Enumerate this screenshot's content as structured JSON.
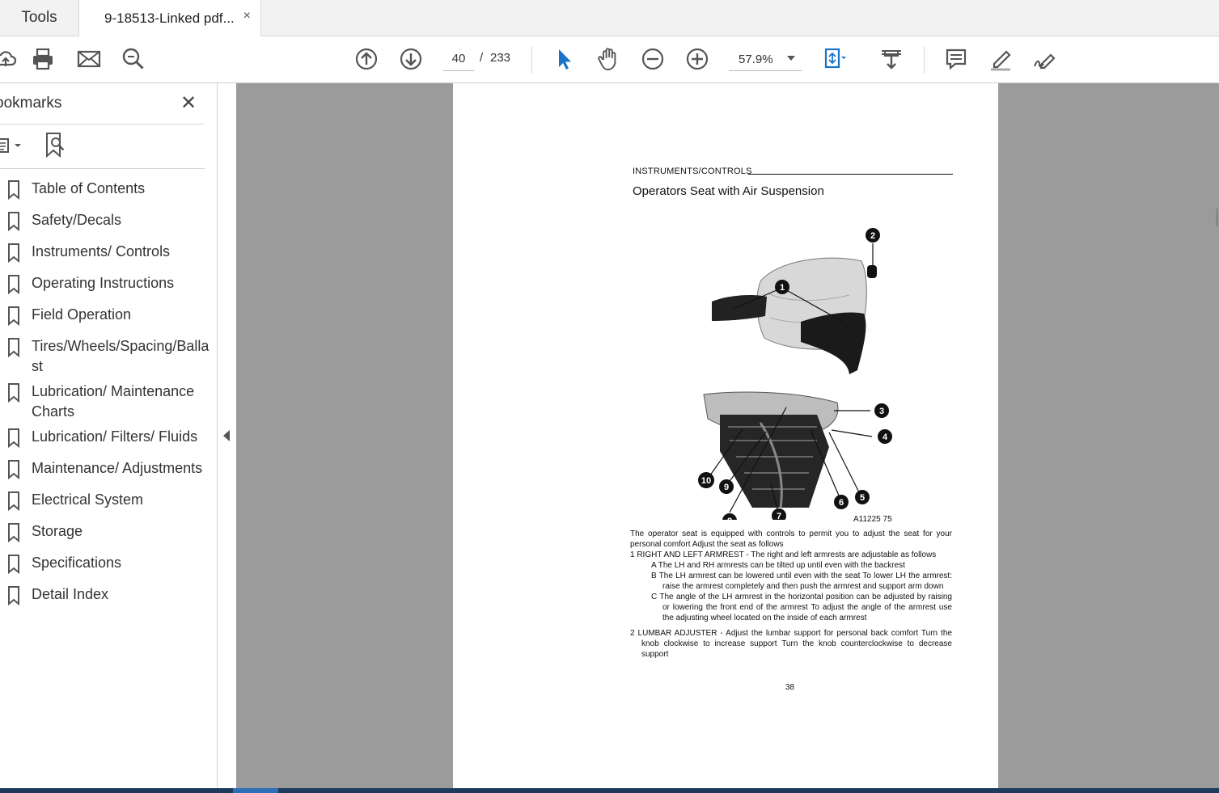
{
  "tabs": {
    "tools_label": "Tools",
    "document_label": "9-18513-Linked pdf...",
    "close_glyph": "×"
  },
  "toolbar": {
    "icons": [
      "cloud-upload-icon",
      "print-icon",
      "email-icon",
      "search-zoom-icon",
      "page-up-icon",
      "page-down-icon",
      "select-arrow-icon",
      "hand-icon",
      "zoom-out-icon",
      "zoom-in-icon",
      "fit-page-icon",
      "scroll-mode-icon",
      "comment-icon",
      "highlight-pen-icon",
      "sign-icon"
    ],
    "current_page": "40",
    "page_separator": "/",
    "total_pages": "233",
    "zoom": "57.9%"
  },
  "sidebar": {
    "title": "ookmarks",
    "close_glyph": "✕",
    "bookmarks": [
      {
        "label": "Table of Contents"
      },
      {
        "label": "Safety/Decals"
      },
      {
        "label": "Instruments/ Controls"
      },
      {
        "label": "Operating Instructions"
      },
      {
        "label": "Field Operation"
      },
      {
        "label": "Tires/Wheels/Spacing/Ballast"
      },
      {
        "label": "Lubrication/ Maintenance Charts"
      },
      {
        "label": "Lubrication/ Filters/ Fluids"
      },
      {
        "label": "Maintenance/ Adjustments"
      },
      {
        "label": "Electrical System"
      },
      {
        "label": "Storage"
      },
      {
        "label": "Specifications"
      },
      {
        "label": "Detail Index"
      }
    ]
  },
  "document": {
    "section_header": "INSTRUMENTS/CONTROLS",
    "title": "Operators Seat with Air Suspension",
    "figure_caption": "A11225 75",
    "callouts": [
      "1",
      "2",
      "3",
      "4",
      "5",
      "6",
      "7",
      "8",
      "9",
      "10"
    ],
    "intro": "The operator seat is equipped with controls to permit you to adjust the seat for your personal comfort Adjust the seat as follows",
    "item1": "1 RIGHT AND LEFT ARMREST - The right and left armrests are adjustable as follows",
    "item1a": "A The LH and RH armrests can be tilted up until even with the backrest",
    "item1b": "B The LH armrest can be lowered until even with the seat To lower LH the armrest: raise the armrest completely and then push the armrest and support arm down",
    "item1c": "C The angle of the LH armrest in the horizontal position can be adjusted by raising or lowering the front end of the armrest To adjust the angle of the armrest use the adjusting wheel located on the inside of each armrest",
    "item2": "2 LUMBAR ADJUSTER - Adjust the lumbar support for personal back comfort Turn the knob clockwise to increase support Turn the knob counterclockwise to decrease support",
    "page_number": "38"
  },
  "colors": {
    "tabbar_bg": "#f2f2f2",
    "document_bg": "#9b9b9b",
    "accent_blue": "#1a73c8",
    "taskbar": "#1f3a5c"
  }
}
